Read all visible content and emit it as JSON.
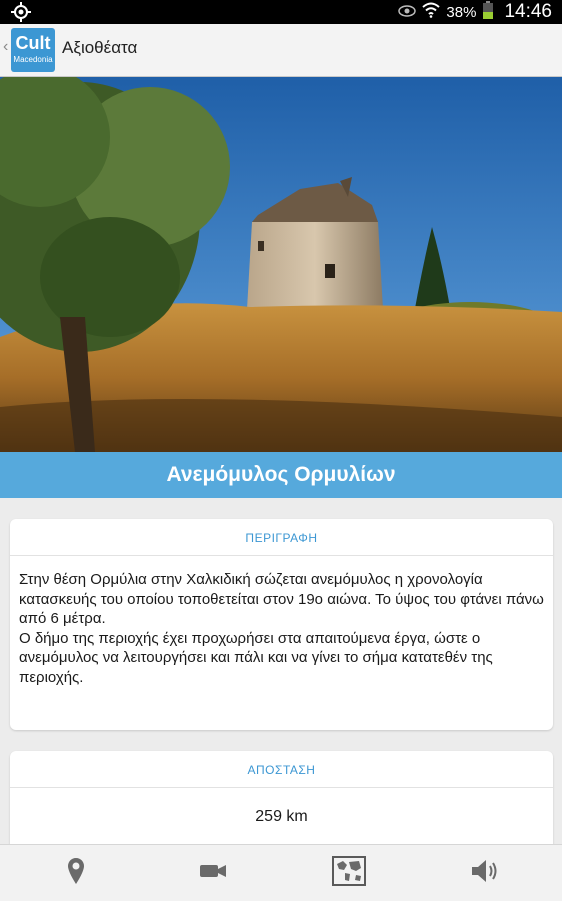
{
  "status_bar": {
    "battery": "38%",
    "time": "14:46"
  },
  "action_bar": {
    "logo_line1": "Cult",
    "logo_line2": "Macedonia",
    "title": "Αξιοθέατα",
    "back_glyph": "‹"
  },
  "sight": {
    "name": "Ανεμόμυλος Ορμυλίων",
    "image_icon": "windmill-photo"
  },
  "description": {
    "header": "ΠΕΡΙΓΡΑΦΗ",
    "text": "Στην θέση Ορμύλια στην Χαλκιδική σώζεται ανεμόμυλος η χρονολογία κατασκευής του οποίου τοποθετείται στον 19ο αιώνα. Το ύψος του φτάνει πάνω από 6 μέτρα.\nΟ δήμο της περιοχής έχει προχωρήσει  στα απαιτούμενα έργα, ώστε ο ανεμόμυλος να λειτουργήσει και πάλι και να γίνει το σήμα κατατεθέν της περιοχής."
  },
  "distance": {
    "header": "ΑΠΟΣΤΑΣΗ",
    "value": "259 km"
  },
  "bottom_tabs": [
    {
      "icon": "location-pin-icon"
    },
    {
      "icon": "video-camera-icon"
    },
    {
      "icon": "map-icon"
    },
    {
      "icon": "speaker-icon"
    }
  ],
  "colors": {
    "accent": "#3c97d3",
    "title_bar": "#56a9dc"
  }
}
